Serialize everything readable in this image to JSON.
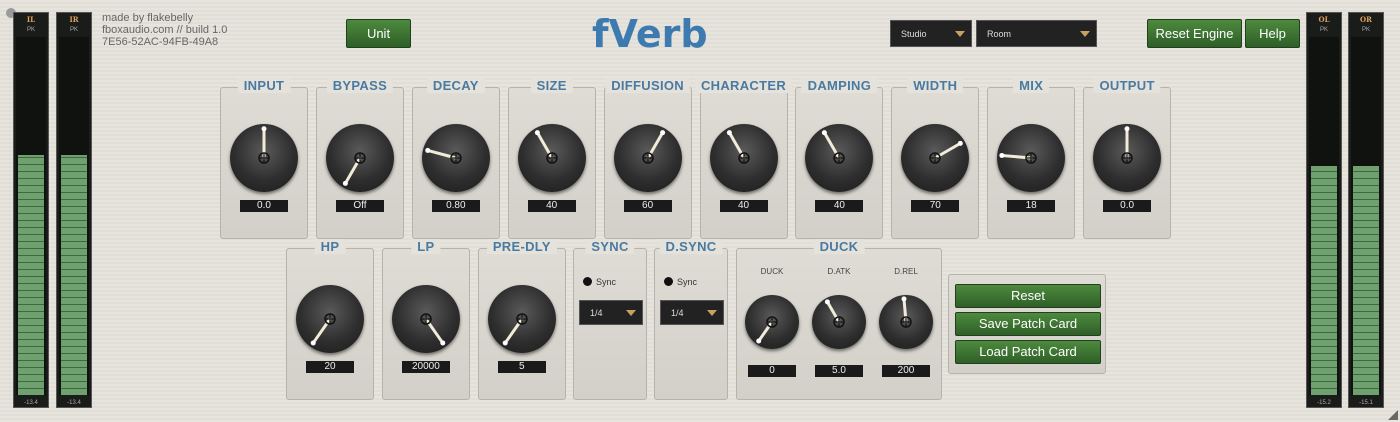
{
  "header": {
    "credit_line": "made by flakebelly",
    "site_line": "fboxaudio.com // build 1.0",
    "id_line": "7E56-52AC-94FB-49A8",
    "title": "fVerb",
    "unit_button": "Unit",
    "type_select": "Studio",
    "preset_select": "Room",
    "reset_engine_button": "Reset Engine",
    "help_button": "Help"
  },
  "meters": {
    "in_left": {
      "label": "IL",
      "peak_label": "PK",
      "value": "-13.4",
      "level": 0.67
    },
    "in_right": {
      "label": "IR",
      "peak_label": "PK",
      "value": "-13.4",
      "level": 0.67
    },
    "out_left": {
      "label": "OL",
      "peak_label": "PK",
      "value": "-15.2",
      "level": 0.64
    },
    "out_right": {
      "label": "OR",
      "peak_label": "PK",
      "value": "-15.1",
      "level": 0.64
    }
  },
  "knobs_row1": [
    {
      "label": "INPUT",
      "value": "0.0",
      "angle": 0
    },
    {
      "label": "BYPASS",
      "value": "Off",
      "angle": -150
    },
    {
      "label": "DECAY",
      "value": "0.80",
      "angle": -75
    },
    {
      "label": "SIZE",
      "value": "40",
      "angle": -30
    },
    {
      "label": "DIFFUSION",
      "value": "60",
      "angle": 30
    },
    {
      "label": "CHARACTER",
      "value": "40",
      "angle": -30
    },
    {
      "label": "DAMPING",
      "value": "40",
      "angle": -30
    },
    {
      "label": "WIDTH",
      "value": "70",
      "angle": 60
    },
    {
      "label": "MIX",
      "value": "18",
      "angle": -85
    },
    {
      "label": "OUTPUT",
      "value": "0.0",
      "angle": 0
    }
  ],
  "knobs_row2": [
    {
      "label": "HP",
      "value": "20",
      "angle": -145
    },
    {
      "label": "LP",
      "value": "20000",
      "angle": 145
    },
    {
      "label": "PRE-DLY",
      "value": "5",
      "angle": -145
    }
  ],
  "sync": {
    "label": "SYNC",
    "toggle_label": "Sync",
    "division": "1/4"
  },
  "dsync": {
    "label": "D.SYNC",
    "toggle_label": "Sync",
    "division": "1/4"
  },
  "duck": {
    "label": "DUCK",
    "knobs": [
      {
        "label": "DUCK",
        "value": "0",
        "angle": -145
      },
      {
        "label": "D.ATK",
        "value": "5.0",
        "angle": -30
      },
      {
        "label": "D.REL",
        "value": "200",
        "angle": -5
      }
    ]
  },
  "patch": {
    "reset_button": "Reset",
    "save_button": "Save Patch Card",
    "load_button": "Load Patch Card"
  },
  "colors": {
    "accent_blue": "#4a7aa2",
    "button_green": "#3f7a33",
    "meter_green": "#6fa06f"
  }
}
